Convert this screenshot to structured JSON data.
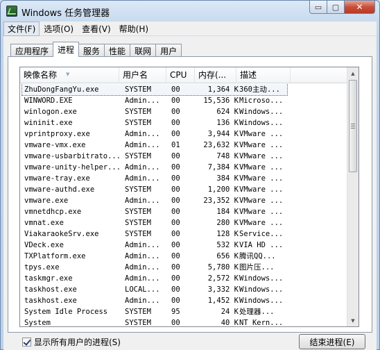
{
  "window": {
    "title": "Windows 任务管理器",
    "caption": {
      "minimize": "▭",
      "maximize": "▢",
      "close": "✕"
    }
  },
  "menu": [
    "文件(F)",
    "选项(O)",
    "查看(V)",
    "帮助(H)"
  ],
  "tabs": [
    "应用程序",
    "进程",
    "服务",
    "性能",
    "联网",
    "用户"
  ],
  "columns": [
    "映像名称",
    "用户名",
    "CPU",
    "内存(...",
    "描述"
  ],
  "processes": [
    {
      "name": "ZhuDongFangYu.exe",
      "user": "SYSTEM",
      "cpu": "00",
      "mem": "1,364 K",
      "desc": "360主动..."
    },
    {
      "name": "WINWORD.EXE",
      "user": "Admin...",
      "cpu": "00",
      "mem": "15,536 K",
      "desc": "Microso..."
    },
    {
      "name": "winlogon.exe",
      "user": "SYSTEM",
      "cpu": "00",
      "mem": "624 K",
      "desc": "Windows..."
    },
    {
      "name": "wininit.exe",
      "user": "SYSTEM",
      "cpu": "00",
      "mem": "136 K",
      "desc": "Windows..."
    },
    {
      "name": "vprintproxy.exe",
      "user": "Admin...",
      "cpu": "00",
      "mem": "3,944 K",
      "desc": "VMware ..."
    },
    {
      "name": "vmware-vmx.exe",
      "user": "Admin...",
      "cpu": "01",
      "mem": "23,632 K",
      "desc": "VMware ..."
    },
    {
      "name": "vmware-usbarbitrato...",
      "user": "SYSTEM",
      "cpu": "00",
      "mem": "748 K",
      "desc": "VMware ..."
    },
    {
      "name": "vmware-unity-helper...",
      "user": "Admin...",
      "cpu": "00",
      "mem": "7,384 K",
      "desc": "VMware ..."
    },
    {
      "name": "vmware-tray.exe",
      "user": "Admin...",
      "cpu": "00",
      "mem": "384 K",
      "desc": "VMware ..."
    },
    {
      "name": "vmware-authd.exe",
      "user": "SYSTEM",
      "cpu": "00",
      "mem": "1,200 K",
      "desc": "VMware ..."
    },
    {
      "name": "vmware.exe",
      "user": "Admin...",
      "cpu": "00",
      "mem": "23,352 K",
      "desc": "VMware ..."
    },
    {
      "name": "vmnetdhcp.exe",
      "user": "SYSTEM",
      "cpu": "00",
      "mem": "184 K",
      "desc": "VMware ..."
    },
    {
      "name": "vmnat.exe",
      "user": "SYSTEM",
      "cpu": "00",
      "mem": "280 K",
      "desc": "VMware ..."
    },
    {
      "name": "ViakaraokeSrv.exe",
      "user": "SYSTEM",
      "cpu": "00",
      "mem": "128 K",
      "desc": "Service..."
    },
    {
      "name": "VDeck.exe",
      "user": "Admin...",
      "cpu": "00",
      "mem": "532 K",
      "desc": "VIA HD ..."
    },
    {
      "name": "TXPlatform.exe",
      "user": "Admin...",
      "cpu": "00",
      "mem": "656 K",
      "desc": "腾讯QQ..."
    },
    {
      "name": "tpys.exe",
      "user": "Admin...",
      "cpu": "00",
      "mem": "5,780 K",
      "desc": "图片压..."
    },
    {
      "name": "taskmgr.exe",
      "user": "Admin...",
      "cpu": "00",
      "mem": "2,572 K",
      "desc": "Windows..."
    },
    {
      "name": "taskhost.exe",
      "user": "LOCAL...",
      "cpu": "00",
      "mem": "3,332 K",
      "desc": "Windows..."
    },
    {
      "name": "taskhost.exe",
      "user": "Admin...",
      "cpu": "00",
      "mem": "1,452 K",
      "desc": "Windows..."
    },
    {
      "name": "System Idle Process",
      "user": "SYSTEM",
      "cpu": "95",
      "mem": "24 K",
      "desc": "处理器..."
    },
    {
      "name": "System",
      "user": "SYSTEM",
      "cpu": "00",
      "mem": "40 K",
      "desc": "NT Kern..."
    }
  ],
  "footer": {
    "show_all_label": "显示所有用户的进程(S)",
    "end_process_label": "结束进程(E)"
  }
}
